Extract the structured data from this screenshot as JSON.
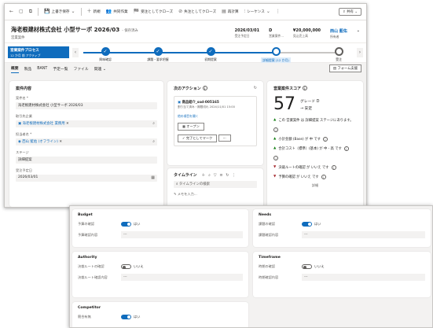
{
  "commandbar": {
    "items": [
      {
        "icon": "←",
        "label": ""
      },
      {
        "icon": "▢",
        "label": ""
      },
      {
        "icon": "⧉",
        "label": ""
      },
      {
        "icon": "💾",
        "label": "上書き保存"
      },
      {
        "icon": "＋",
        "label": "新規"
      },
      {
        "icon": "👥",
        "label": "共同作業"
      },
      {
        "icon": "🏁",
        "label": "受注としてクローズ"
      },
      {
        "icon": "⊘",
        "label": "失注としてクローズ"
      },
      {
        "icon": "▤",
        "label": "再計算"
      },
      {
        "icon": "⫶",
        "label": "シーケンス"
      }
    ],
    "share_label": "共有"
  },
  "header": {
    "title": "海老根建材株式会社 小型サーボ 2026/03",
    "saved": "- 保存済み",
    "subtitle": "営業案件",
    "fields": [
      {
        "value": "2026/03/01",
        "label": "受注予定日"
      },
      {
        "value": "D",
        "label": "営業案件..."
      },
      {
        "value": "¥20,000,000",
        "label": "見込売上高"
      },
      {
        "value": "西山 藍佑",
        "label": "所有者"
      }
    ]
  },
  "bpf": {
    "tag_title": "営業案件プロセス",
    "tag_sub": "12 か月 前 アクティブ",
    "stages": [
      {
        "label": "興味確認",
        "state": "done"
      },
      {
        "label": "課題・要求把握",
        "state": "done"
      },
      {
        "label": "初期提案",
        "state": "done"
      },
      {
        "label": "詳細提案 (12 か月)",
        "state": "active"
      },
      {
        "label": "受注",
        "state": "todo"
      }
    ]
  },
  "tabs": [
    "概要",
    "製品",
    "BANT",
    "予定一覧",
    "ファイル",
    "関連 ⌄"
  ],
  "form_support": "フォーム支援",
  "details": {
    "title": "案件内容",
    "fields": [
      {
        "label": "案件名 *",
        "value": "海老根建材株式会社 小型サーボ 2026/03",
        "link": false
      },
      {
        "label": "取引先企業",
        "value": "海老根建材株式会社 業務用",
        "link": true
      },
      {
        "label": "担当者名 *",
        "value": "西山 藍佑 (オフライン)",
        "link": true
      },
      {
        "label": "ステージ",
        "value": "詳細提案",
        "link": false
      },
      {
        "label": "受注予定日",
        "value": "2026/03/01",
        "link": false
      }
    ]
  },
  "next_action": {
    "title": "次のアクション",
    "item_title": "商品紹介_ssd-005165",
    "item_sub": "割り当て済み・期限切れ 2024/11/01 15:00",
    "link": "他の項目を開く",
    "open_button": "オープン",
    "complete_button": "完了としてマーク",
    "more": "···"
  },
  "timeline": {
    "title": "タイムライン",
    "search_placeholder": "タイムラインの検索",
    "note_placeholder": "メモを入力..."
  },
  "score": {
    "title": "営業案件スコア",
    "value": "57",
    "grade": "グレード D",
    "trend": "→ 安定",
    "insights": [
      {
        "dir": "up",
        "text": "この 営業案件 は 詳細提案 ステージにあります。"
      },
      {
        "dir": "none",
        "text": ""
      },
      {
        "dir": "up",
        "text": "小計金額 (Base) が 中 です"
      },
      {
        "dir": "up",
        "text": "合計コスト（標準）(基本) が 中 - 高 です"
      },
      {
        "dir": "none",
        "text": ""
      },
      {
        "dir": "down",
        "text": "決裁ルートの確認 が いいえ です"
      },
      {
        "dir": "down",
        "text": "予算の確認 が いいえ です"
      }
    ],
    "footer": "詳細"
  },
  "bant": {
    "budget": {
      "title": "Budget",
      "rows": [
        {
          "type": "toggle",
          "label": "予算の確認",
          "on": true,
          "value": "はい"
        },
        {
          "type": "input",
          "label": "予算確認内容",
          "value": "---"
        }
      ]
    },
    "needs": {
      "title": "Needs",
      "rows": [
        {
          "type": "toggle",
          "label": "課題の確認",
          "on": true,
          "value": "はい"
        },
        {
          "type": "input",
          "label": "課題確認内容",
          "value": "---"
        }
      ]
    },
    "authority": {
      "title": "Authority",
      "rows": [
        {
          "type": "toggle",
          "label": "決裁ルートの確認",
          "on": false,
          "value": "いいえ"
        },
        {
          "type": "input",
          "label": "決裁ルート確認内容",
          "value": "---"
        }
      ]
    },
    "timeframe": {
      "title": "Timeframe",
      "rows": [
        {
          "type": "toggle",
          "label": "時期の確認",
          "on": false,
          "value": "いいえ"
        },
        {
          "type": "input",
          "label": "時期確認内容",
          "value": "---"
        }
      ]
    },
    "competitor": {
      "title": "Competitor",
      "rows": [
        {
          "type": "toggle",
          "label": "競合有無",
          "on": true,
          "value": "はい"
        }
      ]
    }
  },
  "colors": {
    "accent": "#0f6cbd",
    "positive": "#107c10",
    "negative": "#a4262c"
  }
}
